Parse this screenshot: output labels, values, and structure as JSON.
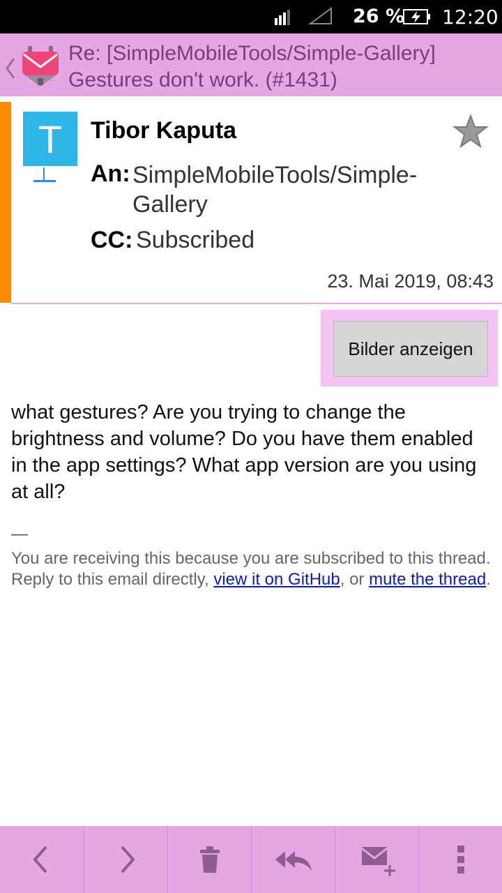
{
  "statusbar": {
    "battery_percent": "26 %",
    "time": "12:20",
    "icons": [
      "signal-icon",
      "no-sim-icon",
      "battery-charging-icon"
    ]
  },
  "header": {
    "subject": "Re: [SimpleMobileTools/Simple-Gallery] Gestures don't work. (#1431)",
    "accent_color": "#e4a7e4",
    "text_color": "#7a3b7a"
  },
  "sender": {
    "avatar_letter": "T",
    "avatar_color": "#2fb6e8",
    "name": "Tibor Kaputa",
    "to_label": "An:",
    "to_value": "SimpleMobileTools/Simple-Gallery",
    "cc_label": "CC:",
    "cc_value": "Subscribed",
    "date": "23. Mai 2019, 08:43",
    "accent_bar_color": "#ff8a00"
  },
  "images": {
    "show_label": "Bilder anzeigen"
  },
  "message": {
    "body": "what gestures? Are you trying to change the brightness and volume? Do you have them enabled in the app settings? What app version are you using at all?",
    "sig_dash": "—",
    "footer_line1": "You are receiving this because you are subscribed to this thread.",
    "footer_reply_prefix": "Reply to this email directly, ",
    "footer_link1": "view it on GitHub",
    "footer_mid": ", or ",
    "footer_link2": "mute the thread",
    "footer_end": "."
  },
  "toolbar": {
    "buttons": [
      "previous-icon",
      "next-icon",
      "delete-icon",
      "reply-all-icon",
      "compose-icon",
      "more-icon"
    ]
  }
}
